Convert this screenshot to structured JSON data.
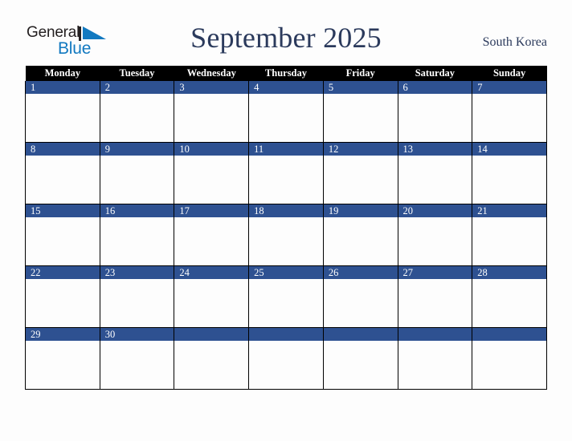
{
  "brand": {
    "name_part1": "General",
    "name_part2": "Blue",
    "triangle_icon": "brand-triangle-icon",
    "color_dark": "#231f20",
    "color_blue": "#1279c0"
  },
  "header": {
    "title": "September 2025",
    "locale": "South Korea",
    "title_color": "#2b3a5c"
  },
  "calendar": {
    "header_bg": "#000000",
    "header_fg": "#ffffff",
    "date_band_bg": "#2e5191",
    "date_band_fg": "#ffffff",
    "cell_bg": "#fdfdfd",
    "grid_line": "#000000",
    "weekday_headers": [
      "Monday",
      "Tuesday",
      "Wednesday",
      "Thursday",
      "Friday",
      "Saturday",
      "Sunday"
    ],
    "weeks": [
      {
        "days": [
          {
            "num": "1"
          },
          {
            "num": "2"
          },
          {
            "num": "3"
          },
          {
            "num": "4"
          },
          {
            "num": "5"
          },
          {
            "num": "6"
          },
          {
            "num": "7"
          }
        ]
      },
      {
        "days": [
          {
            "num": "8"
          },
          {
            "num": "9"
          },
          {
            "num": "10"
          },
          {
            "num": "11"
          },
          {
            "num": "12"
          },
          {
            "num": "13"
          },
          {
            "num": "14"
          }
        ]
      },
      {
        "days": [
          {
            "num": "15"
          },
          {
            "num": "16"
          },
          {
            "num": "17"
          },
          {
            "num": "18"
          },
          {
            "num": "19"
          },
          {
            "num": "20"
          },
          {
            "num": "21"
          }
        ]
      },
      {
        "days": [
          {
            "num": "22"
          },
          {
            "num": "23"
          },
          {
            "num": "24"
          },
          {
            "num": "25"
          },
          {
            "num": "26"
          },
          {
            "num": "27"
          },
          {
            "num": "28"
          }
        ]
      },
      {
        "days": [
          {
            "num": "29"
          },
          {
            "num": "30"
          },
          {
            "num": ""
          },
          {
            "num": ""
          },
          {
            "num": ""
          },
          {
            "num": ""
          },
          {
            "num": ""
          }
        ]
      }
    ]
  }
}
